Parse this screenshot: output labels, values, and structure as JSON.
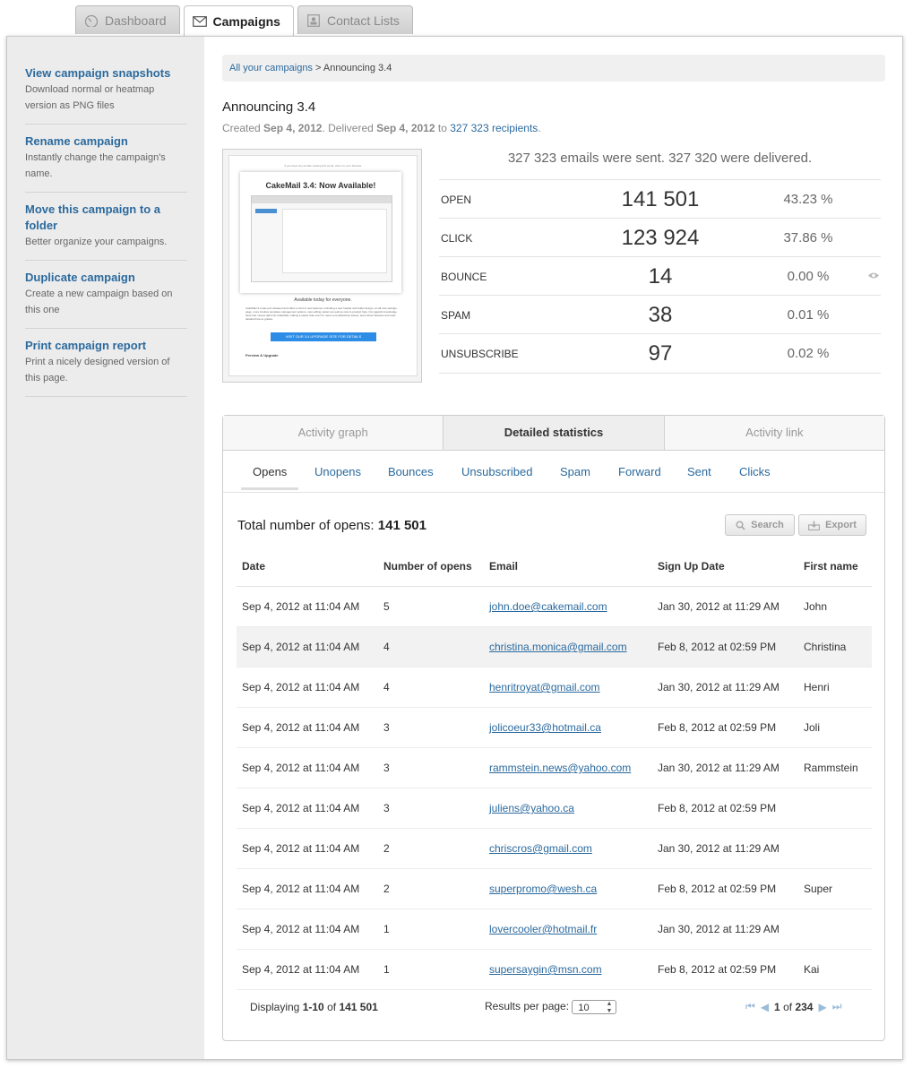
{
  "tabs": [
    {
      "label": "Dashboard",
      "icon": "gauge-icon",
      "active": false
    },
    {
      "label": "Campaigns",
      "icon": "envelope-icon",
      "active": true
    },
    {
      "label": "Contact Lists",
      "icon": "contact-card-icon",
      "active": false
    }
  ],
  "sidebar": {
    "items": [
      {
        "title": "View campaign snapshots",
        "desc": "Download normal or heatmap version as PNG files"
      },
      {
        "title": "Rename campaign",
        "desc": "Instantly change the campaign's name."
      },
      {
        "title": "Move this campaign to a folder",
        "desc": "Better organize your campaigns."
      },
      {
        "title": "Duplicate campaign",
        "desc": "Create a new campaign based on this one"
      },
      {
        "title": "Print campaign report",
        "desc": "Print a nicely designed version of this page."
      }
    ]
  },
  "breadcrumb": {
    "link": "All your campaigns",
    "sep": ">",
    "current": "Announcing 3.4"
  },
  "campaign": {
    "title": "Announcing 3.4",
    "created_label": "Created",
    "created_date": "Sep 4, 2012",
    "delivered_label": ". Delivered",
    "delivered_date": "Sep 4, 2012",
    "to_label": "to",
    "recipients": "327 323 recipients",
    "period": "."
  },
  "preview": {
    "top_note": "If you have any trouble viewing this email, view it in your browser",
    "headline": "CakeMail 3.4: Now Available!",
    "caption": "Available today for everyone.",
    "body": "CakeMail 3.4 was just released and offers a host of new features, including a new header and folder design, an all new settings page, more intuitive template management options, new editing options as well as new in-product help. Our gigantic knowledge base has moved right into CakeMail, making it easier than ever for users to troubleshoot issues, learn about features and read detailed how-to guides.",
    "cta": "VISIT OUR 3.4 UPGRADE SITE FOR DETAILS",
    "section": "Preview & Upgrade"
  },
  "summary": "327 323 emails were sent. 327 320 were delivered.",
  "stats": [
    {
      "label": "OPEN",
      "value": "141 501",
      "pct": "43.23 %"
    },
    {
      "label": "CLICK",
      "value": "123 924",
      "pct": "37.86 %"
    },
    {
      "label": "BOUNCE",
      "value": "14",
      "pct": "0.00 %"
    },
    {
      "label": "SPAM",
      "value": "38",
      "pct": "0.01 %"
    },
    {
      "label": "UNSUBSCRIBE",
      "value": "97",
      "pct": "0.02 %"
    }
  ],
  "panel_tabs": [
    "Activity graph",
    "Detailed statistics",
    "Activity link"
  ],
  "sub_tabs": [
    "Opens",
    "Unopens",
    "Bounces",
    "Unsubscribed",
    "Spam",
    "Forward",
    "Sent",
    "Clicks"
  ],
  "total": {
    "label": "Total number of opens:",
    "value": "141 501"
  },
  "buttons": {
    "search": "Search",
    "export": "Export"
  },
  "table": {
    "headers": [
      "Date",
      "Number of opens",
      "Email",
      "Sign Up Date",
      "First name"
    ],
    "rows": [
      [
        "Sep 4, 2012 at 11:04 AM",
        "5",
        "john.doe@cakemail.com",
        "Jan 30, 2012 at 11:29 AM",
        "John"
      ],
      [
        "Sep 4, 2012 at 11:04 AM",
        "4",
        "christina.monica@gmail.com",
        "Feb 8, 2012 at 02:59 PM",
        "Christina"
      ],
      [
        "Sep 4, 2012 at 11:04 AM",
        "4",
        "henritroyat@gmail.com",
        "Jan 30, 2012 at 11:29 AM",
        "Henri"
      ],
      [
        "Sep 4, 2012 at 11:04 AM",
        "3",
        "jolicoeur33@hotmail.ca",
        "Feb 8, 2012 at 02:59 PM",
        "Joli"
      ],
      [
        "Sep 4, 2012 at 11:04 AM",
        "3",
        "rammstein.news@yahoo.com",
        "Jan 30, 2012 at 11:29 AM",
        "Rammstein"
      ],
      [
        "Sep 4, 2012 at 11:04 AM",
        "3",
        "juliens@yahoo.ca",
        "Feb 8, 2012 at 02:59 PM",
        ""
      ],
      [
        "Sep 4, 2012 at 11:04 AM",
        "2",
        "chriscros@gmail.com",
        "Jan 30, 2012 at 11:29 AM",
        ""
      ],
      [
        "Sep 4, 2012 at 11:04 AM",
        "2",
        "superpromo@wesh.ca",
        "Feb 8, 2012 at 02:59 PM",
        "Super"
      ],
      [
        "Sep 4, 2012 at 11:04 AM",
        "1",
        "lovercooler@hotmail.fr",
        "Jan 30, 2012 at 11:29 AM",
        ""
      ],
      [
        "Sep 4, 2012 at 11:04 AM",
        "1",
        "supersaygin@msn.com",
        "Feb 8, 2012 at 02:59 PM",
        "Kai"
      ]
    ]
  },
  "footer": {
    "displaying_label": "Displaying",
    "range": "1-10",
    "of_label": "of",
    "total": "141 501",
    "per_page_label": "Results per page:",
    "per_page_value": "10",
    "page": "1",
    "of_pages_label": "of",
    "pages": "234"
  },
  "colors": {
    "link": "#2b6a9e",
    "sidebar_bg": "#ececec",
    "alt_row": "#f2f2f2"
  }
}
